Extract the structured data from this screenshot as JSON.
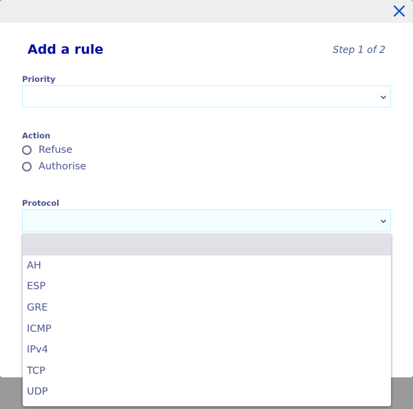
{
  "modal": {
    "title": "Add a rule",
    "step": "Step 1 of 2",
    "close_icon": "close-icon"
  },
  "priority": {
    "label": "Priority",
    "value": ""
  },
  "action": {
    "label": "Action",
    "options": [
      {
        "label": "Refuse",
        "selected": false
      },
      {
        "label": "Authorise",
        "selected": false
      }
    ]
  },
  "protocol": {
    "label": "Protocol",
    "value": "",
    "options": [
      "",
      "AH",
      "ESP",
      "GRE",
      "ICMP",
      "IPv4",
      "TCP",
      "UDP"
    ],
    "highlighted_index": 0
  },
  "colors": {
    "title": "#000e9c",
    "text": "#4d5693",
    "field_border": "#bef1ff",
    "highlight": "#e0e0e6",
    "close": "#0050d7"
  }
}
